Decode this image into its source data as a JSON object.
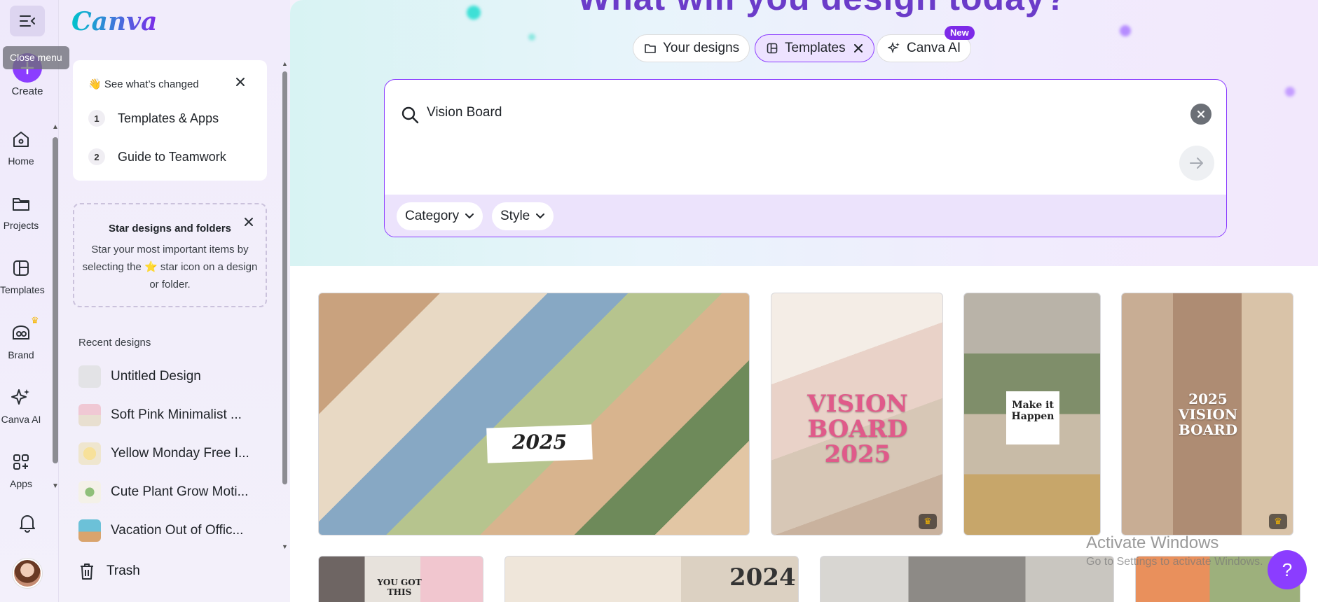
{
  "app": {
    "logo": "Canva"
  },
  "rail": {
    "toggle_tooltip": "Close menu",
    "create_label": "Create",
    "items": [
      {
        "label": "Home",
        "icon": "home-icon"
      },
      {
        "label": "Projects",
        "icon": "folder-icon"
      },
      {
        "label": "Templates",
        "icon": "templates-icon"
      },
      {
        "label": "Brand",
        "icon": "brand-icon"
      },
      {
        "label": "Canva AI",
        "icon": "sparkle-icon"
      },
      {
        "label": "Apps",
        "icon": "apps-icon"
      }
    ]
  },
  "panel": {
    "whats_changed": {
      "title": "👋 See what’s changed",
      "steps": [
        {
          "num": "1",
          "label": "Templates & Apps"
        },
        {
          "num": "2",
          "label": "Guide to Teamwork"
        }
      ]
    },
    "star_tip": {
      "title": "Star designs and folders",
      "body": "Star your most important items by selecting the ⭐ star icon on a design or folder."
    },
    "recent_title": "Recent designs",
    "recent": [
      {
        "label": "Untitled Design",
        "color": "#e3e3e6"
      },
      {
        "label": "Soft Pink Minimalist ...",
        "color": "#f5d3dc"
      },
      {
        "label": "Yellow Monday Free I...",
        "color": "#f7e7b0"
      },
      {
        "label": "Cute Plant Grow Moti...",
        "color": "#d9ead2"
      },
      {
        "label": "Vacation Out of Offic...",
        "color": "#7fc7d9"
      }
    ],
    "trash_label": "Trash"
  },
  "main": {
    "hero_title": "What will you design today?",
    "tabs": [
      {
        "label": "Your designs",
        "icon": "folder-icon"
      },
      {
        "label": "Templates",
        "icon": "templates-icon",
        "active": true
      },
      {
        "label": "Canva AI",
        "icon": "sparkle-icon",
        "badge": "New"
      }
    ],
    "search": {
      "value": "Vision Board",
      "filters": [
        "Category",
        "Style"
      ]
    },
    "results": [
      {
        "caption": "2025"
      },
      {
        "caption": "VISION BOARD 2025"
      },
      {
        "caption": "Make it Happen"
      },
      {
        "caption": "2025 VISION BOARD"
      },
      {
        "caption": "YOU GOT THIS"
      },
      {
        "caption": "2024"
      },
      {
        "caption": ""
      },
      {
        "caption": ""
      }
    ]
  },
  "system": {
    "watermark_title": "Activate Windows",
    "watermark_sub": "Go to Settings to activate Windows."
  },
  "colors": {
    "accent": "#8b3dff",
    "badge": "#7d2ae8"
  }
}
